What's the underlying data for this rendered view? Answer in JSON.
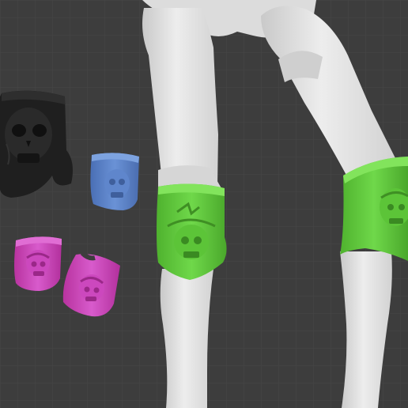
{
  "scene": {
    "background": "#3d3d3d",
    "grid_color": "#474747",
    "objects": [
      {
        "name": "black-skull-knee-guard",
        "color": "#1f1f1f"
      },
      {
        "name": "blue-skull-knee-guard",
        "color": "#5a82c8"
      },
      {
        "name": "pink-skull-knee-guard",
        "color": "#c63fb8"
      },
      {
        "name": "magenta-skull-knee-guard",
        "color": "#c53ab0"
      },
      {
        "name": "green-skull-knee-guard-left-leg",
        "color": "#5ec93a"
      },
      {
        "name": "green-skull-knee-guard-right-leg",
        "color": "#62c73e"
      },
      {
        "name": "doll-legs",
        "color": "#e2e2e2"
      }
    ]
  }
}
